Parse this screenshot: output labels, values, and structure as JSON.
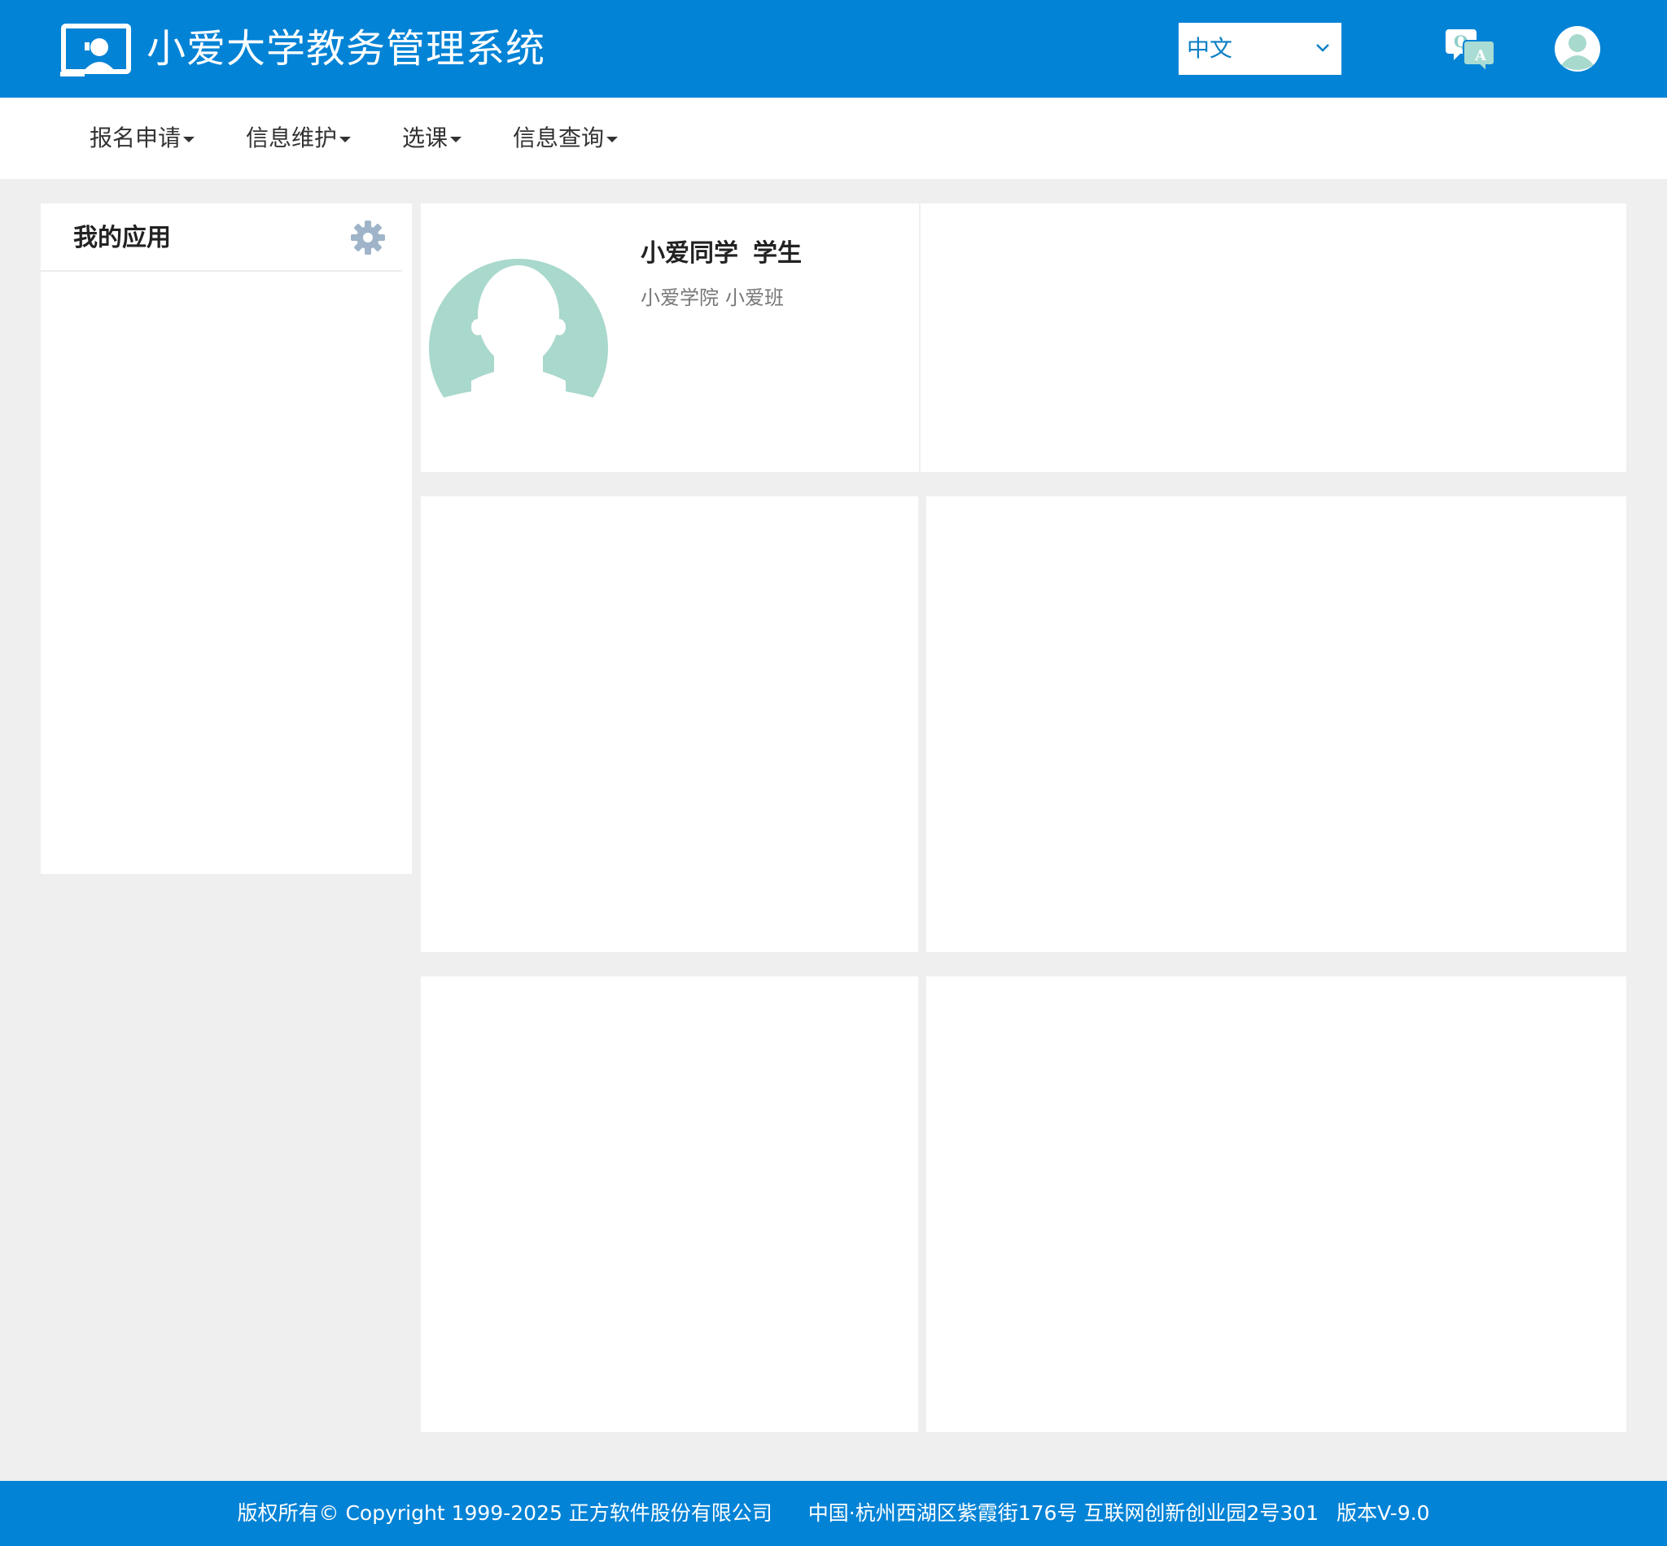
{
  "header": {
    "title": "小爱大学教务管理系统",
    "language": "中文",
    "icons": [
      "logo-icon",
      "qa-translate-icon",
      "user-avatar-icon"
    ],
    "brand_color": "#0383d6"
  },
  "nav": {
    "items": [
      {
        "label": "报名申请"
      },
      {
        "label": "信息维护"
      },
      {
        "label": "选课"
      },
      {
        "label": "信息查询"
      }
    ]
  },
  "apps": {
    "title": "我的应用"
  },
  "profile": {
    "name": "小爱同学",
    "role": "学生",
    "college": "小爱学院",
    "class": "小爱班"
  },
  "footer": {
    "copyright": "版权所有© Copyright 1999-2025 正方软件股份有限公司",
    "address": "中国·杭州西湖区紫霞街176号 互联网创新创业园2号301",
    "version": "版本V-9.0"
  }
}
